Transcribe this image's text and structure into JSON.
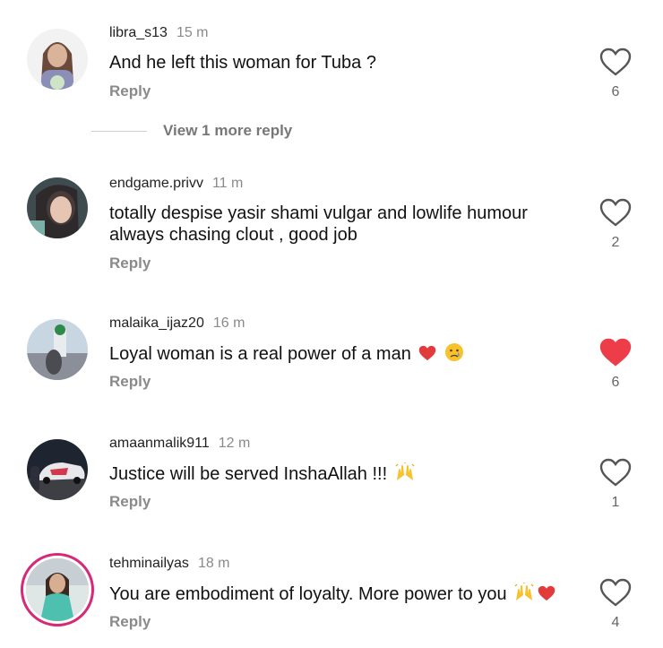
{
  "comments": [
    {
      "username": "libra_s13",
      "time": "15 m",
      "text": "And he left this woman for Tuba ?",
      "reply": "Reply",
      "likes": "6",
      "liked": false
    },
    {
      "username": "endgame.privv",
      "time": "11 m",
      "text": "totally despise yasir shami vulgar and lowlife humour always chasing clout , good job",
      "reply": "Reply",
      "likes": "2",
      "liked": false
    },
    {
      "username": "malaika_ijaz20",
      "time": "16 m",
      "text": "Loyal woman is a real power of a man",
      "reply": "Reply",
      "likes": "6",
      "liked": true
    },
    {
      "username": "amaanmalik911",
      "time": "12 m",
      "text": "Justice will be served InshaAllah !!!",
      "reply": "Reply",
      "likes": "1",
      "liked": false
    },
    {
      "username": "tehminailyas",
      "time": "18 m",
      "text": "You are embodiment of loyalty. More power to you",
      "reply": "Reply",
      "likes": "4",
      "liked": false
    }
  ],
  "view_more": "View 1 more reply",
  "colors": {
    "liked_heart": "#ed3d48",
    "muted_text": "#8a8a8a",
    "story_ring": "#d62976"
  }
}
